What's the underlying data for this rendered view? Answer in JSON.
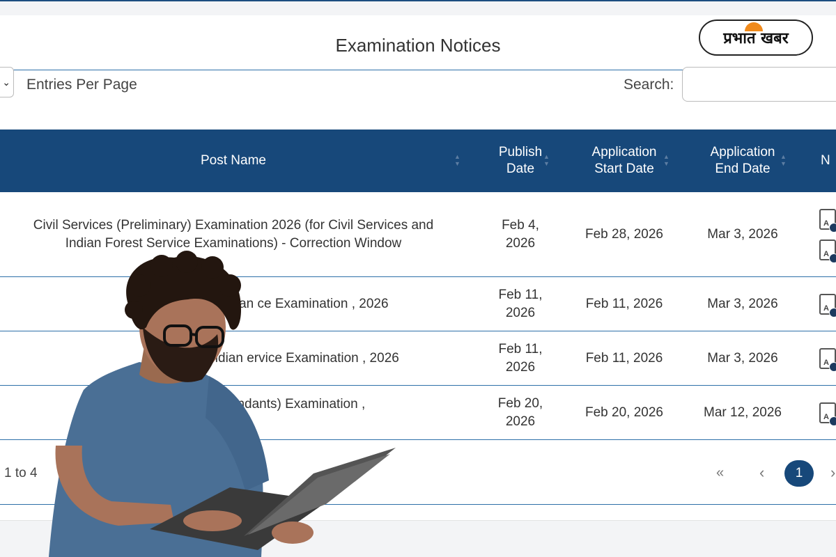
{
  "header": {
    "title": "Examination Notices",
    "logo_text": "प्रभात खबर"
  },
  "controls": {
    "entries_label": "Entries Per Page",
    "search_label": "Search:",
    "search_value": ""
  },
  "table": {
    "columns": [
      "Post Name",
      "Publish Date",
      "Application Start Date",
      "Application End Date",
      "N"
    ],
    "rows": [
      {
        "post": "Civil Services (Preliminary) Examination 2026 (for Civil Services and Indian Forest Service Examinations) - Correction Window",
        "publish": "Feb 4, 2026",
        "start": "Feb 28, 2026",
        "end": "Mar 3, 2026"
      },
      {
        "post": "Indian ce Examination , 2026",
        "publish": "Feb 11, 2026",
        "start": "Feb 11, 2026",
        "end": "Mar 3, 2026"
      },
      {
        "post": "Indian ervice Examination , 2026",
        "publish": "Feb 11, 2026",
        "start": "Feb 11, 2026",
        "end": "Mar 3, 2026"
      },
      {
        "post": "Central ant Commandants) Examination ,",
        "publish": "Feb 20, 2026",
        "start": "Feb 20, 2026",
        "end": "Mar 12, 2026"
      }
    ]
  },
  "footer": {
    "info": "1 to 4",
    "first_label": "«",
    "prev_label": "‹",
    "current_page": "1",
    "next_label": "›"
  },
  "icons": {
    "notice": "pdf-document-icon",
    "dropdown": "chevron-down-icon"
  },
  "colors": {
    "header_bg": "#17487a",
    "rule": "#2d6fa8",
    "logo_accent": "#f08a1c"
  }
}
